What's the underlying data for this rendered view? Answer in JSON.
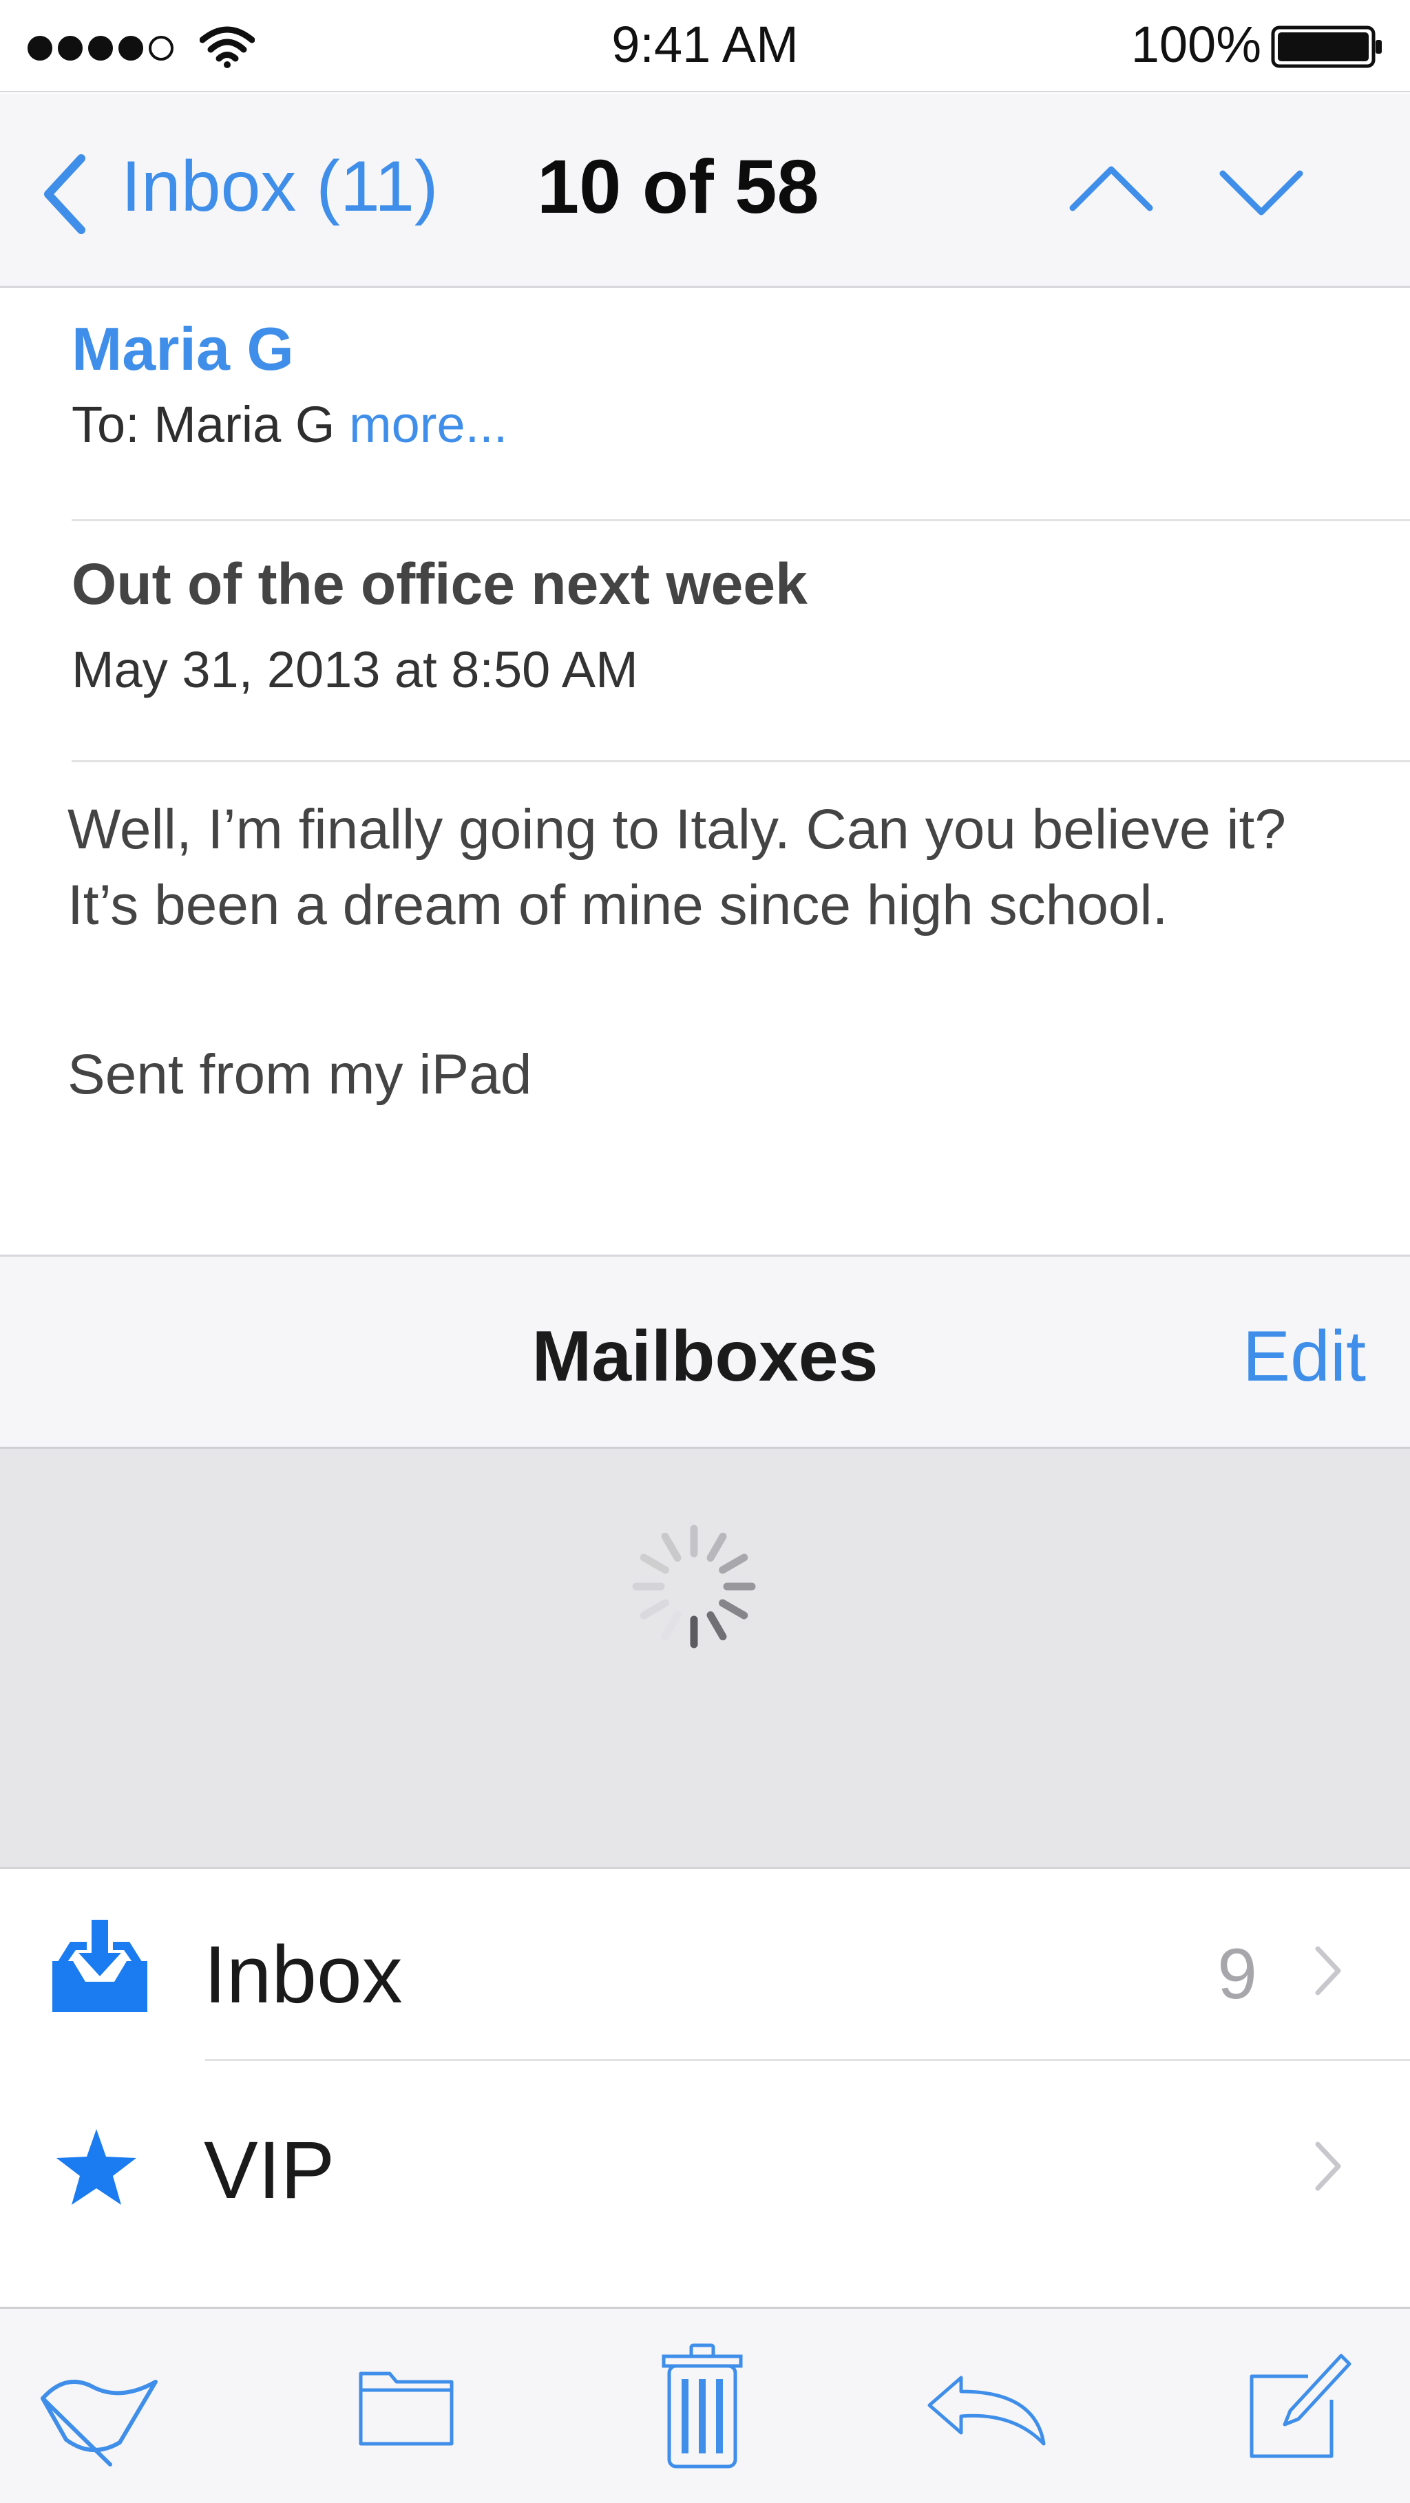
{
  "status_bar": {
    "time": "9:41 AM",
    "battery_percent": "100%",
    "signal_bars_filled": 4,
    "signal_bars_total": 5,
    "icons": [
      "signal-dots-icon",
      "wifi-icon",
      "battery-icon"
    ]
  },
  "message_nav": {
    "back_label": "Inbox (11)",
    "counter": "10 of 58",
    "icons": [
      "chevron-left-icon",
      "chevron-up-icon",
      "chevron-down-icon"
    ]
  },
  "message": {
    "from": "Maria G",
    "to_prefix": "To: Maria G ",
    "to_more": "more...",
    "subject": "Out of the office next week",
    "date": "May 31, 2013 at 8:50 AM",
    "body": "Well, I’m finally going to Italy. Can you believe it? It’s been a dream of mine since high school.",
    "signature": "Sent from my iPad"
  },
  "mailboxes": {
    "title": "Mailboxes",
    "edit_label": "Edit",
    "loading": true,
    "items": [
      {
        "label": "Inbox",
        "count": "9",
        "icon": "inbox-tray-icon"
      },
      {
        "label": "VIP",
        "count": "",
        "icon": "star-icon"
      }
    ]
  },
  "toolbar": {
    "items": [
      "flag-icon",
      "folder-icon",
      "trash-icon",
      "reply-icon",
      "compose-icon"
    ]
  },
  "colors": {
    "accent": "#3f8ee9",
    "icon_blue": "#1a7cf0",
    "bar_background": "#f6f6f8",
    "loading_background": "#e6e5e8"
  }
}
